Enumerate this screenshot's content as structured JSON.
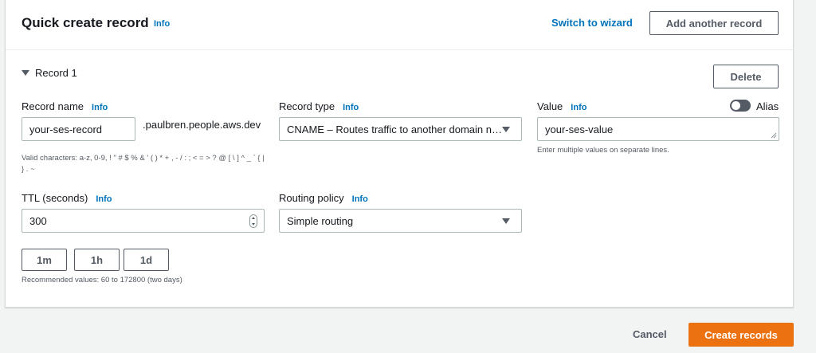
{
  "header": {
    "title": "Quick create record",
    "info": "Info",
    "switch_wizard": "Switch to wizard",
    "add_record": "Add another record"
  },
  "record": {
    "title": "Record 1",
    "delete": "Delete",
    "record_name": {
      "label": "Record name",
      "info": "Info",
      "value": "your-ses-record",
      "suffix": ".paulbren.people.aws.dev",
      "hint": "Valid characters: a-z, 0-9, ! \" # $ % & ' ( ) * + , - / : ; < = > ? @ [ \\ ] ^ _ ` { | } . ~"
    },
    "record_type": {
      "label": "Record type",
      "info": "Info",
      "value": "CNAME – Routes traffic to another domain name and to some AWS resources"
    },
    "value": {
      "label": "Value",
      "info": "Info",
      "value": "your-ses-value",
      "hint": "Enter multiple values on separate lines."
    },
    "alias": {
      "label": "Alias",
      "enabled": false
    },
    "ttl": {
      "label": "TTL (seconds)",
      "info": "Info",
      "value": "300",
      "presets": [
        "1m",
        "1h",
        "1d"
      ],
      "hint": "Recommended values: 60 to 172800 (two days)"
    },
    "routing_policy": {
      "label": "Routing policy",
      "info": "Info",
      "value": "Simple routing"
    }
  },
  "footer": {
    "cancel": "Cancel",
    "create": "Create records"
  },
  "colors": {
    "accent": "#ec7211",
    "link": "#0073bb",
    "text": "#16191f",
    "muted": "#545b64"
  }
}
